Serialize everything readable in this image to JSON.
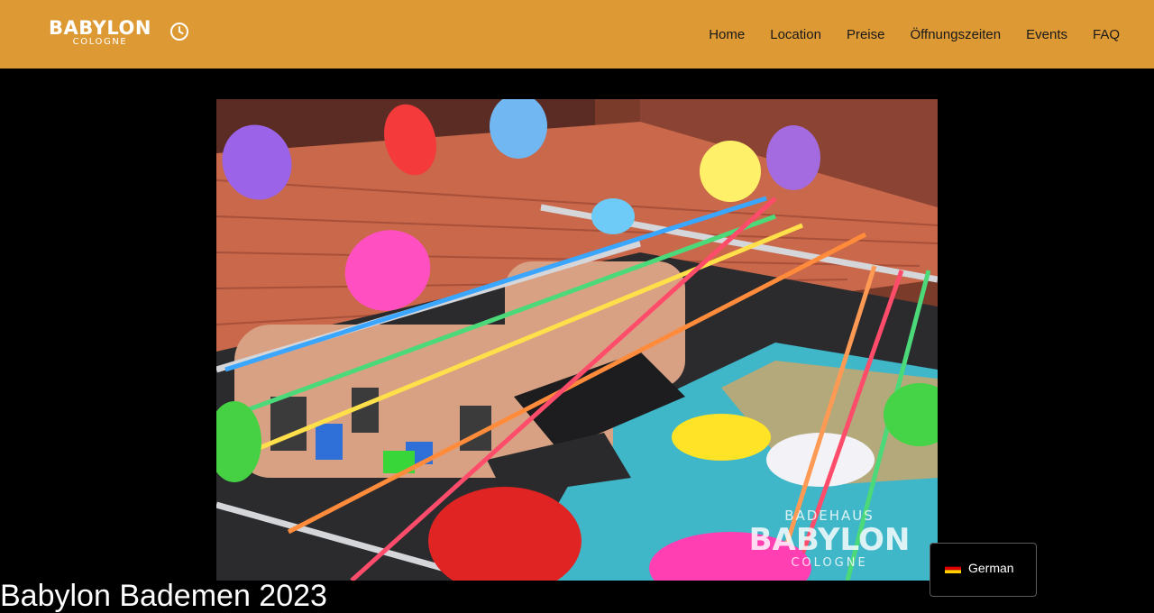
{
  "header": {
    "logo_text": "BABYLON",
    "logo_subtext": "COLOGNE",
    "clock_icon": "clock-icon",
    "background": "#dd9933",
    "nav": [
      {
        "label": "Home"
      },
      {
        "label": "Location"
      },
      {
        "label": "Preise"
      },
      {
        "label": "Öffnungszeiten"
      },
      {
        "label": "Events"
      },
      {
        "label": "FAQ"
      }
    ]
  },
  "hero": {
    "watermark_top": "BADEHAUS",
    "watermark_main": "BABYLON",
    "watermark_sub": "COLOGNE"
  },
  "page_title_partial": "Babylon Bademen 2023",
  "language_switcher": {
    "label": "German",
    "flag_icon": "german-flag-icon"
  }
}
